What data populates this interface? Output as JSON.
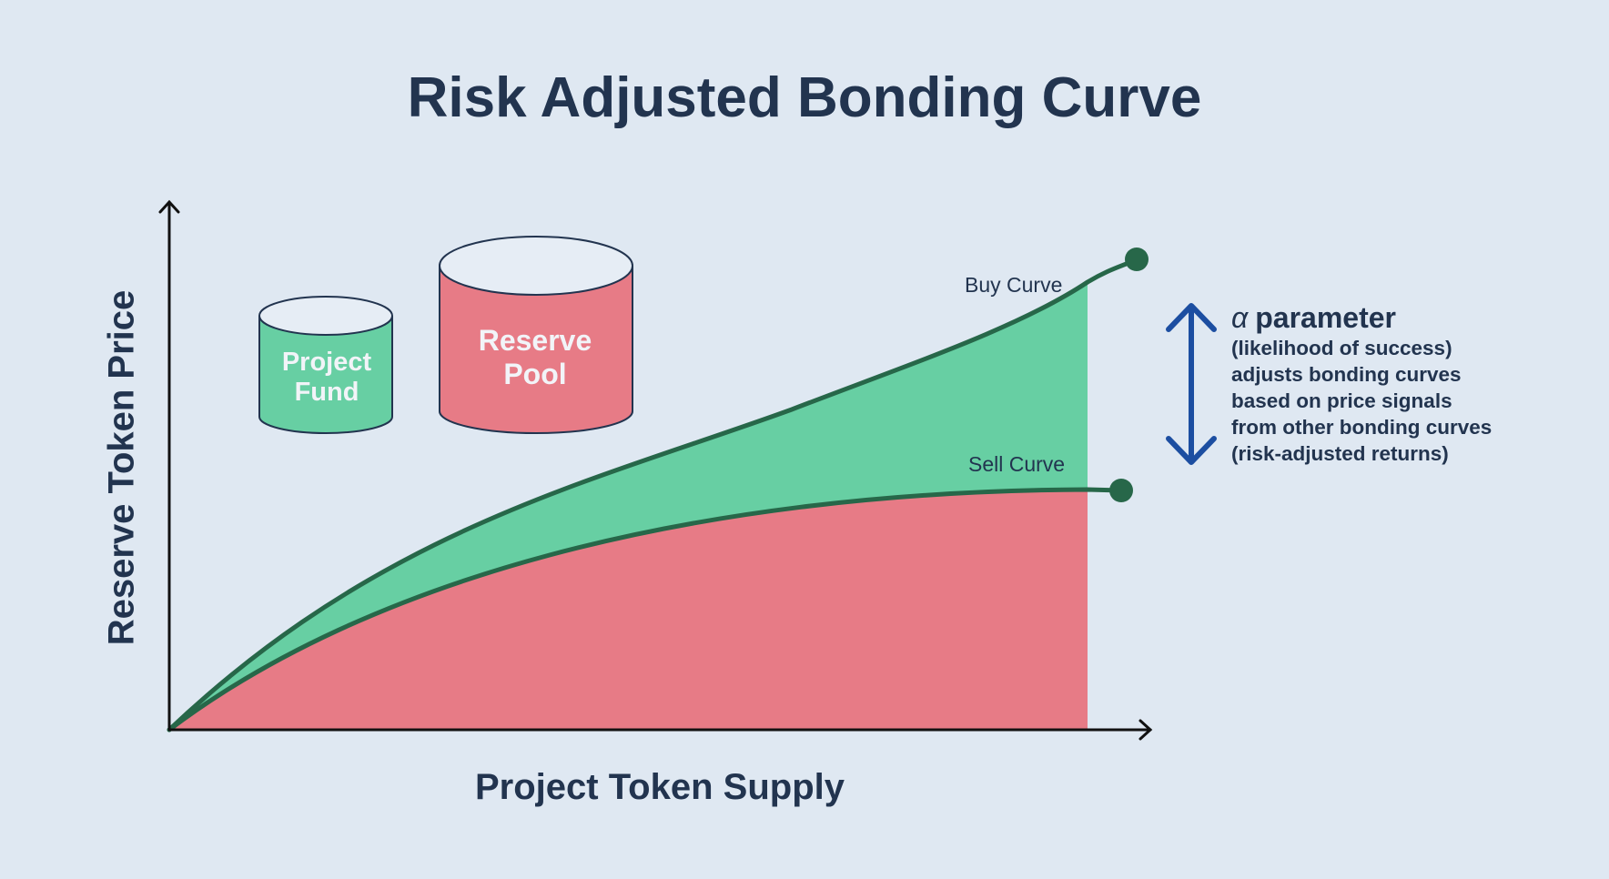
{
  "title": "Risk Adjusted Bonding Curve",
  "axes": {
    "x_label": "Project Token Supply",
    "y_label": "Reserve Token Price"
  },
  "containers": {
    "project_fund": {
      "line1": "Project",
      "line2": "Fund",
      "color": "#67cfa3"
    },
    "reserve_pool": {
      "line1": "Reserve",
      "line2": "Pool",
      "color": "#e77b86"
    }
  },
  "curves": {
    "buy_label": "Buy Curve",
    "sell_label": "Sell Curve",
    "curve_color": "#276749",
    "spread_fill": "#67cfa3",
    "reserve_fill": "#e77b86"
  },
  "alpha": {
    "symbol": "α",
    "heading": "parameter",
    "lines": [
      "(likelihood of success)",
      "adjusts bonding curves",
      "based on price signals",
      "from other bonding curves",
      "(risk-adjusted returns)"
    ],
    "arrow_color": "#1c4ea1"
  },
  "colors": {
    "background": "#dfe8f2",
    "text": "#22344f",
    "axis": "#111111"
  }
}
